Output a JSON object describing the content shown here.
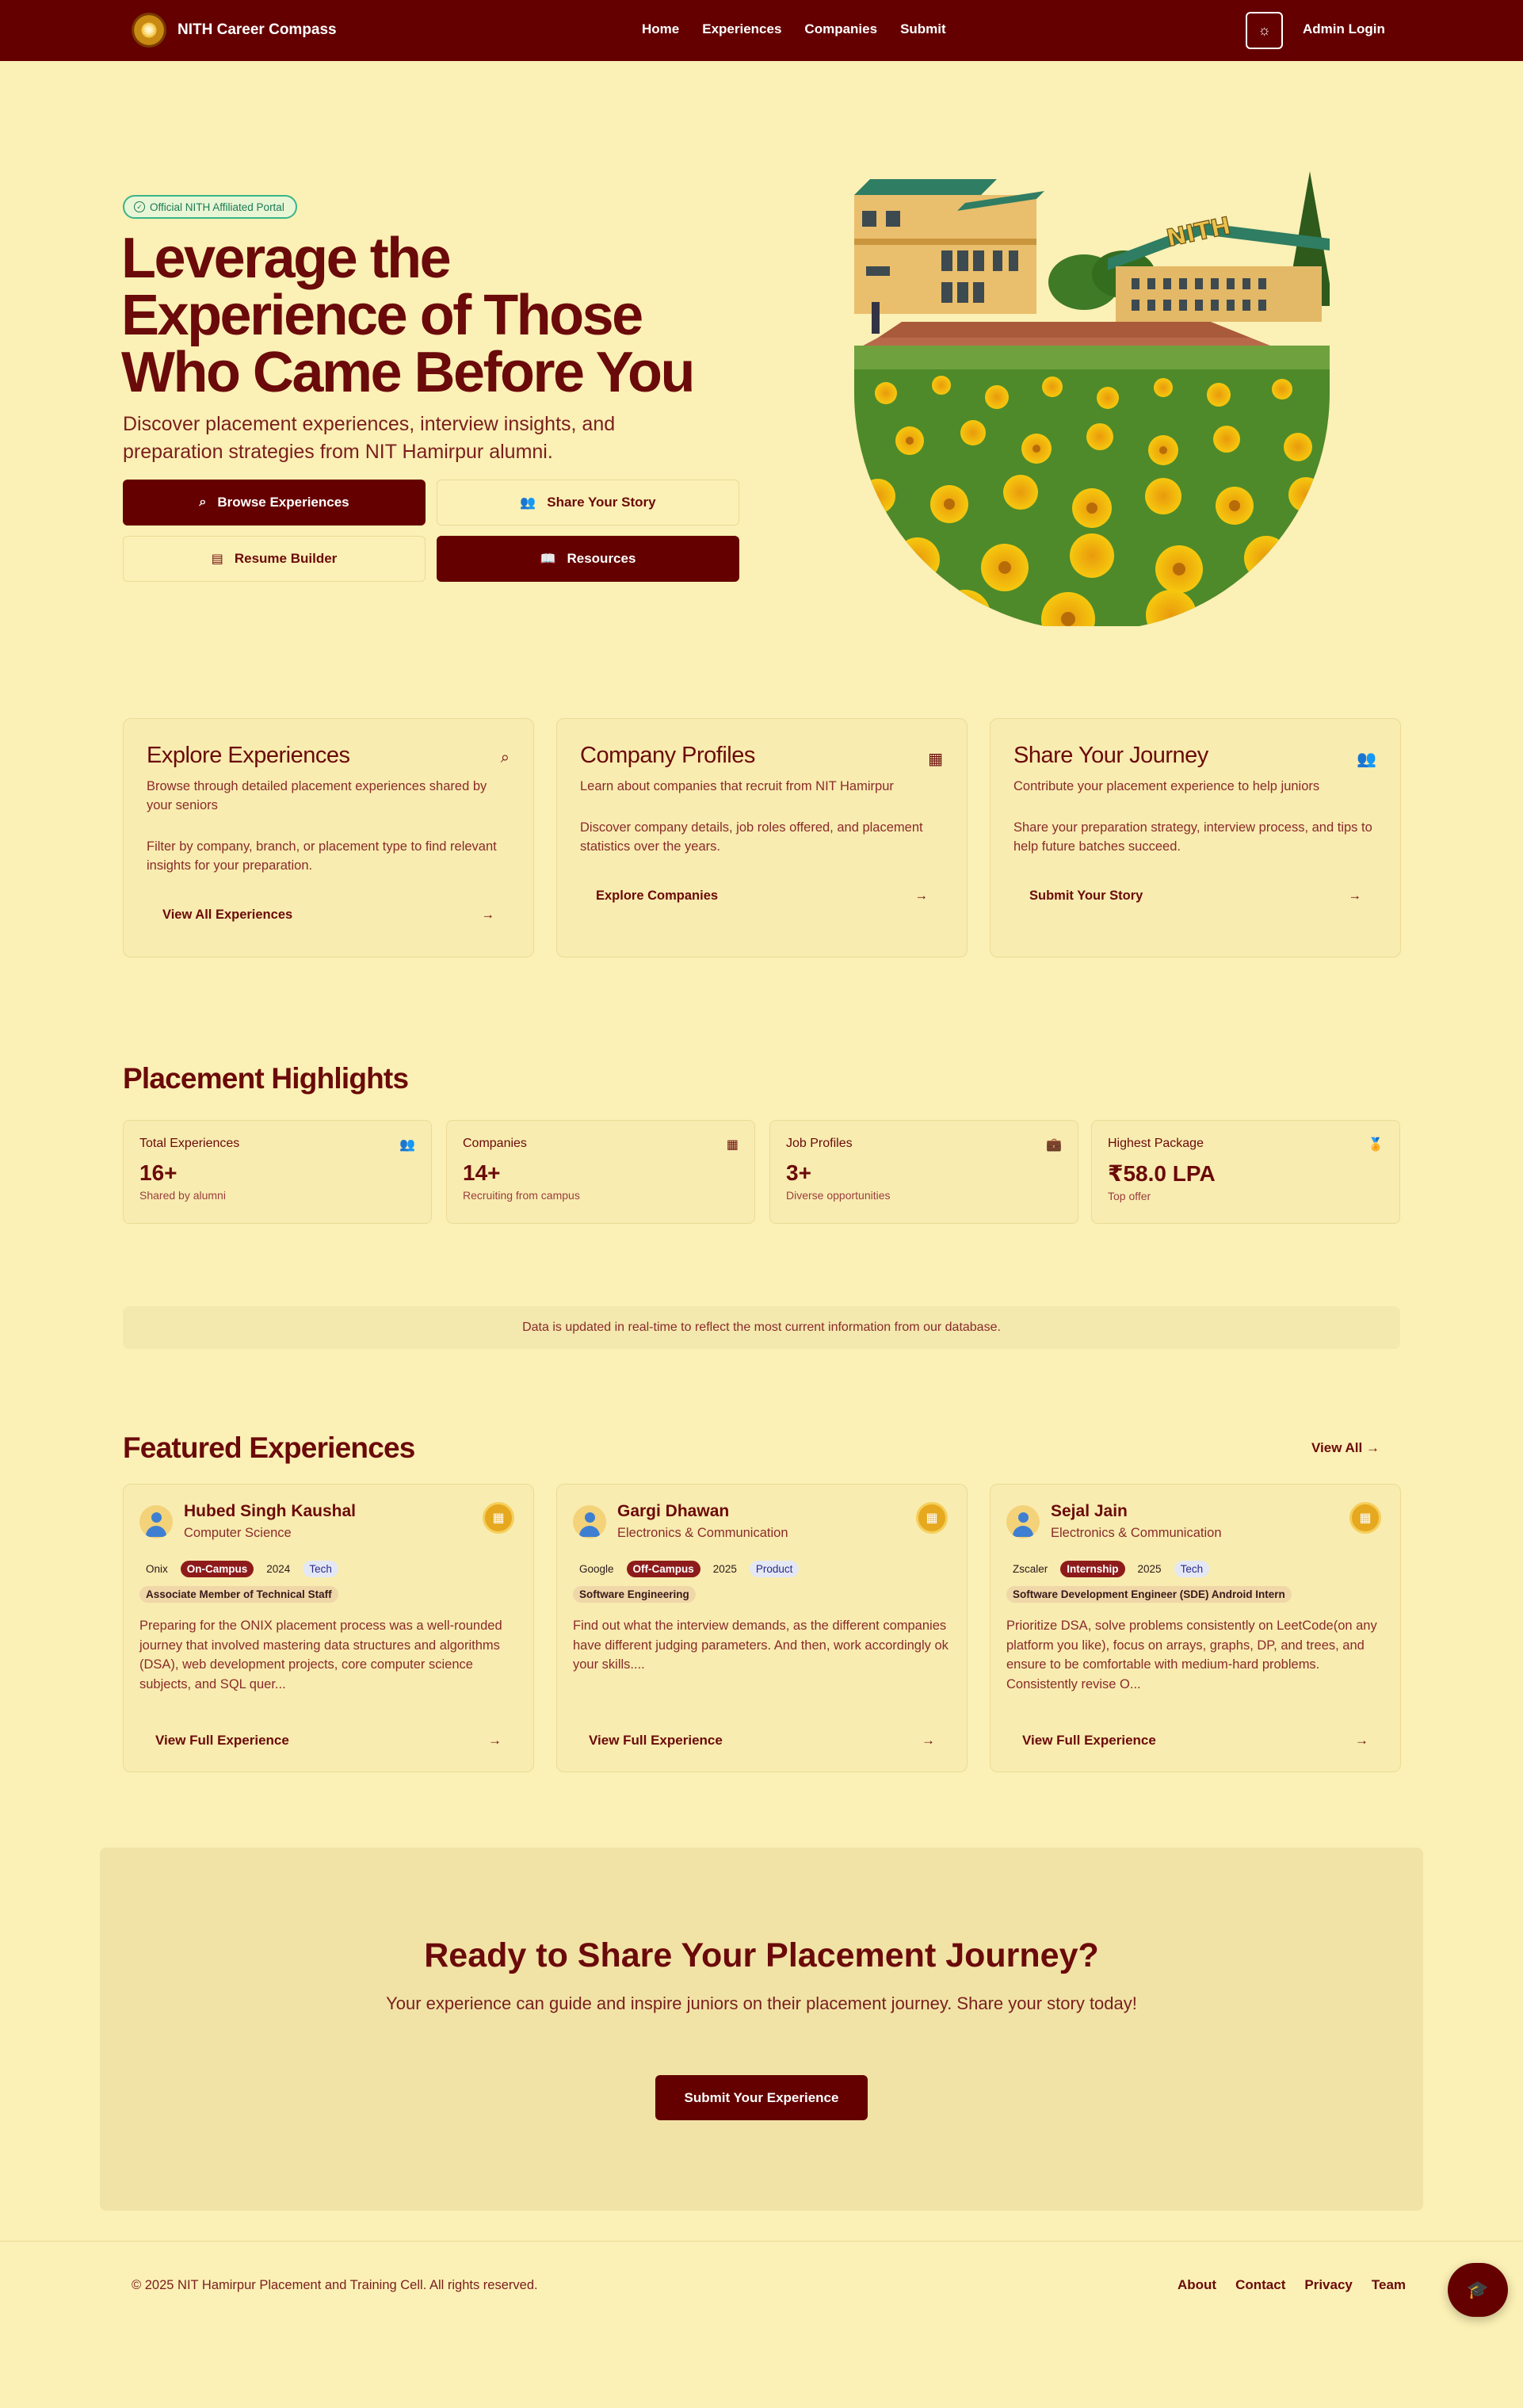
{
  "nav": {
    "brand": "NITH Career Compass",
    "links": [
      "Home",
      "Experiences",
      "Companies",
      "Submit"
    ],
    "admin": "Admin Login"
  },
  "hero": {
    "badge": "Official NITH Affiliated Portal",
    "title": "Leverage the Experience of Those Who Came Before You",
    "subtitle": "Discover placement experiences, interview insights, and preparation strategies from NIT Hamirpur alumni.",
    "buttons": {
      "browse": "Browse Experiences",
      "share": "Share Your Story",
      "resume": "Resume Builder",
      "resources": "Resources"
    },
    "image_sign": "NITH"
  },
  "features": [
    {
      "title": "Explore Experiences",
      "desc": "Browse through detailed placement experiences shared by your seniors",
      "detail": "Filter by company, branch, or placement type to find relevant insights for your preparation.",
      "link": "View All Experiences"
    },
    {
      "title": "Company Profiles",
      "desc": "Learn about companies that recruit from NIT Hamirpur",
      "detail": "Discover company details, job roles offered, and placement statistics over the years.",
      "link": "Explore Companies"
    },
    {
      "title": "Share Your Journey",
      "desc": "Contribute your placement experience to help juniors",
      "detail": "Share your preparation strategy, interview process, and tips to help future batches succeed.",
      "link": "Submit Your Story"
    }
  ],
  "highlights": {
    "title": "Placement Highlights",
    "stats": [
      {
        "label": "Total Experiences",
        "value": "16+",
        "sub": "Shared by alumni"
      },
      {
        "label": "Companies",
        "value": "14+",
        "sub": "Recruiting from campus"
      },
      {
        "label": "Job Profiles",
        "value": "3+",
        "sub": "Diverse opportunities"
      },
      {
        "label": "Highest Package",
        "value": "₹58.0 LPA",
        "sub": "Top offer"
      }
    ],
    "notice": "Data is updated in real-time to reflect the most current information from our database."
  },
  "featured": {
    "title": "Featured Experiences",
    "view_all": "View All",
    "items": [
      {
        "name": "Hubed Singh Kaushal",
        "branch": "Computer Science",
        "company": "Onix",
        "type": "On-Campus",
        "year": "2024",
        "category": "Tech",
        "role": "Associate Member of Technical Staff",
        "excerpt": "Preparing for the ONIX placement process was a well-rounded journey that involved mastering data structures and algorithms (DSA), web development projects, core computer science subjects, and SQL quer...",
        "link": "View Full Experience"
      },
      {
        "name": "Gargi Dhawan",
        "branch": "Electronics & Communication",
        "company": "Google",
        "type": "Off-Campus",
        "year": "2025",
        "category": "Product",
        "role": "Software Engineering",
        "excerpt": "Find out what the interview demands, as the different companies have different judging parameters. And then, work accordingly ok your skills....",
        "link": "View Full Experience"
      },
      {
        "name": "Sejal Jain",
        "branch": "Electronics & Communication",
        "company": "Zscaler",
        "type": "Internship",
        "year": "2025",
        "category": "Tech",
        "role": "Software Development Engineer (SDE) Android Intern",
        "excerpt": "Prioritize DSA, solve problems consistently on LeetCode(on any platform you like), focus on arrays, graphs, DP, and trees, and ensure to be comfortable with medium-hard problems. Consistently revise O...",
        "link": "View Full Experience"
      }
    ]
  },
  "cta": {
    "title": "Ready to Share Your Placement Journey?",
    "text": "Your experience can guide and inspire juniors on their placement journey. Share your story today!",
    "button": "Submit Your Experience"
  },
  "footer": {
    "copyright": "© 2025 NIT Hamirpur Placement and Training Cell. All rights reserved.",
    "links": [
      "About",
      "Contact",
      "Privacy",
      "Team"
    ]
  },
  "colors": {
    "primary": "#650000",
    "background": "#FBF0B5",
    "card": "#F8ECB0",
    "accent_gold": "#E5A81F"
  }
}
